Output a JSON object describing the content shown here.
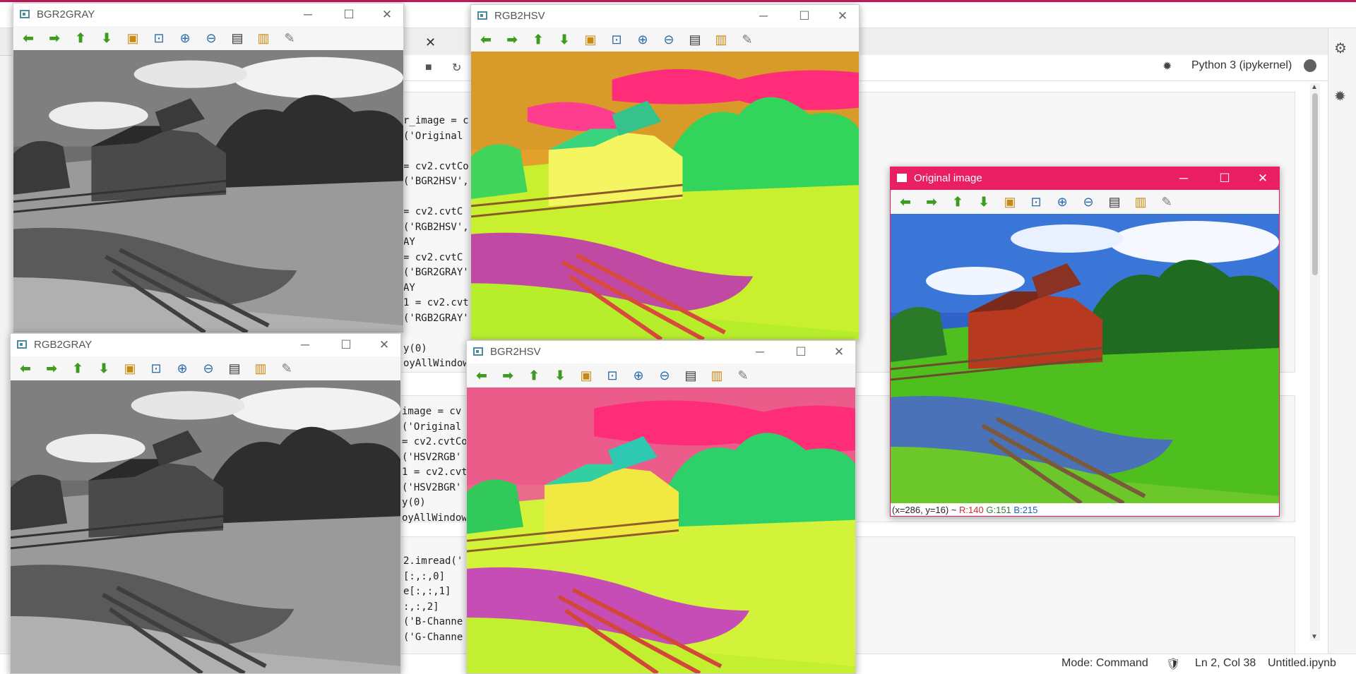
{
  "notebook": {
    "kernel_name": "Python 3 (ipykernel)",
    "code_lines_cell1": [
      "r_image = c",
      "('Original",
      "",
      "= cv2.cvtCo",
      "('BGR2HSV',",
      "",
      "= cv2.cvtC",
      "('RGB2HSV',",
      "AY",
      "= cv2.cvtC",
      "('BGR2GRAY'",
      "AY",
      "1 = cv2.cvt",
      "('RGB2GRAY'",
      "",
      "y(0)",
      "oyAllWindow"
    ],
    "code_lines_cell2": [
      "image = cv",
      "('Original",
      "= cv2.cvtCo",
      "('HSV2RGB'",
      "1 = cv2.cvt",
      "('HSV2BGR'",
      "y(0)",
      "oyAllWindow"
    ],
    "code_lines_cell3": [
      "2.imread('",
      "[:,:,0]",
      "e[:,:,1]",
      ":,:,2]",
      "('B-Channe",
      "('G-Channe"
    ]
  },
  "statusbar": {
    "mode": "Mode: Command",
    "position": "Ln 2, Col 38",
    "filename": "Untitled.ipynb"
  },
  "windows": {
    "bgr2gray": {
      "title": "BGR2GRAY"
    },
    "rgb2gray": {
      "title": "RGB2GRAY"
    },
    "rgb2hsv": {
      "title": "RGB2HSV"
    },
    "bgr2hsv": {
      "title": "BGR2HSV"
    },
    "original": {
      "title": "Original image",
      "status_coords": "(x=286, y=16) ~",
      "status_r": "R:140",
      "status_g": "G:151",
      "status_b": "B:215"
    }
  },
  "window_buttons": {
    "minimize": "─",
    "maximize": "☐",
    "close": "✕"
  },
  "toolbar_tools": [
    {
      "name": "pan-left-icon",
      "glyph": "⬅",
      "cls": "t-green"
    },
    {
      "name": "pan-right-icon",
      "glyph": "➡",
      "cls": "t-green"
    },
    {
      "name": "pan-up-icon",
      "glyph": "⬆",
      "cls": "t-green"
    },
    {
      "name": "pan-down-icon",
      "glyph": "⬇",
      "cls": "t-green"
    },
    {
      "name": "zoom-fit-icon",
      "glyph": "▣",
      "cls": "t-amber"
    },
    {
      "name": "zoom-original-icon",
      "glyph": "⊡",
      "cls": "t-blue"
    },
    {
      "name": "zoom-in-icon",
      "glyph": "⊕",
      "cls": "t-blue"
    },
    {
      "name": "zoom-out-icon",
      "glyph": "⊖",
      "cls": "t-blue"
    },
    {
      "name": "save-icon",
      "glyph": "▤",
      "cls": "t-dark"
    },
    {
      "name": "copy-clipboard-icon",
      "glyph": "▥",
      "cls": "t-amber"
    },
    {
      "name": "properties-icon",
      "glyph": "✎",
      "cls": "t-gray"
    }
  ]
}
